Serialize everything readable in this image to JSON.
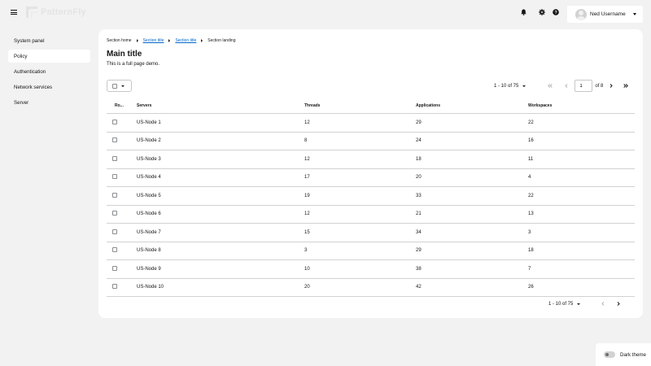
{
  "masthead": {
    "logo_text": "PatternFly",
    "user_name": "Ned Username",
    "icons": [
      "hamburger-menu-icon",
      "bell-icon",
      "gear-icon",
      "question-circle-icon"
    ]
  },
  "sidebar": {
    "items": [
      {
        "label": "System panel",
        "active": false
      },
      {
        "label": "Policy",
        "active": true
      },
      {
        "label": "Authentication",
        "active": false
      },
      {
        "label": "Network services",
        "active": false
      },
      {
        "label": "Server",
        "active": false
      }
    ]
  },
  "breadcrumb": {
    "items": [
      "Section home",
      "Section title",
      "Section title",
      "Section landing"
    ]
  },
  "page": {
    "title": "Main title",
    "subtitle": "This is a full page demo."
  },
  "pagination_top": {
    "range": "1 - 10 of 75",
    "page_value": "1",
    "of_pages": "of 8"
  },
  "pagination_bottom": {
    "range": "1 - 10 of 75"
  },
  "table": {
    "columns": [
      "Ro...",
      "Servers",
      "Threads",
      "Applications",
      "Workspaces"
    ],
    "rows": [
      {
        "server": "US-Node 1",
        "threads": "12",
        "applications": "29",
        "workspaces": "22"
      },
      {
        "server": "US-Node 2",
        "threads": "8",
        "applications": "24",
        "workspaces": "16"
      },
      {
        "server": "US-Node 3",
        "threads": "12",
        "applications": "18",
        "workspaces": "11"
      },
      {
        "server": "US-Node 4",
        "threads": "17",
        "applications": "20",
        "workspaces": "4"
      },
      {
        "server": "US-Node 5",
        "threads": "19",
        "applications": "33",
        "workspaces": "22"
      },
      {
        "server": "US-Node 6",
        "threads": "12",
        "applications": "21",
        "workspaces": "13"
      },
      {
        "server": "US-Node 7",
        "threads": "15",
        "applications": "34",
        "workspaces": "3"
      },
      {
        "server": "US-Node 8",
        "threads": "3",
        "applications": "29",
        "workspaces": "18"
      },
      {
        "server": "US-Node 9",
        "threads": "10",
        "applications": "38",
        "workspaces": "7"
      },
      {
        "server": "US-Node 10",
        "threads": "20",
        "applications": "42",
        "workspaces": "26"
      }
    ]
  },
  "theme": {
    "dark_label": "Dark theme"
  },
  "colors": {
    "link": "#0066cc",
    "background": "#f2f2f2",
    "panel": "#ffffff",
    "border": "#d2d2d2"
  }
}
